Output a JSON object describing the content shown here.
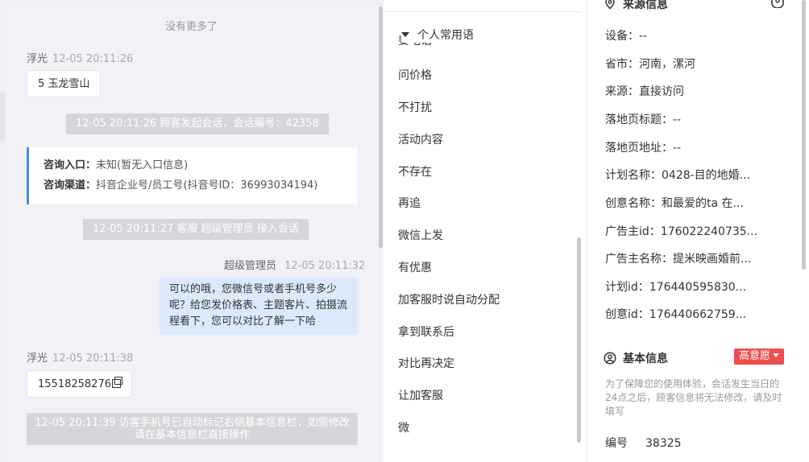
{
  "chat": {
    "no_more": "没有更多了",
    "msg1": {
      "sender": "浮光",
      "time": "12-05 20:11:26",
      "text": "5  玉龙雪山"
    },
    "sys1": "12-05 20:11:26 顾客发起会话，会话编号：42358",
    "card": {
      "entry_label": "咨询入口：",
      "entry_value": "未知(暂无入口信息)",
      "channel_label": "咨询渠道：",
      "channel_value": "抖音企业号/员工号(抖音号ID：36993034194)"
    },
    "sys2": "12-05 20:11:27 客服 超级管理员 接入会话",
    "msg2": {
      "sender": "超级管理员",
      "time": "12-05 20:11:32",
      "text": "可以的哦，您微信号或者手机号多少呢？给您发价格表、主题客片、拍摄流程看下，您可以对比了解一下哈"
    },
    "msg3": {
      "sender": "浮光",
      "time": "12-05 20:11:38",
      "text": "15518258276"
    },
    "sys3": "12-05 20:11:39 访客手机号已自动标记右侧基本信息栏，如需修改请在基本信息栏直接操作"
  },
  "phrases": {
    "header": "个人常用语",
    "cut_item": "要电话",
    "items": [
      "问价格",
      "不打扰",
      "活动内容",
      "不存在",
      "再追",
      "微信上发",
      "有优惠",
      "加客服时说自动分配",
      "拿到联系后",
      "对比再决定",
      "让加客服",
      "微"
    ]
  },
  "source": {
    "title": "来源信息",
    "rows": [
      {
        "k": "设备：",
        "v": "--"
      },
      {
        "k": "省市：",
        "v": "河南，漯河"
      },
      {
        "k": "来源：",
        "v": "直接访问"
      },
      {
        "k": "落地页标题：",
        "v": "--"
      },
      {
        "k": "落地页地址：",
        "v": "--"
      },
      {
        "k": "计划名称：",
        "v": "0428-目的地婚..."
      },
      {
        "k": "创意名称：",
        "v": "和最爱的ta 在..."
      },
      {
        "k": "广告主id：",
        "v": "176022240735..."
      },
      {
        "k": "广告主名称：",
        "v": "提米映画婚前..."
      },
      {
        "k": "计划id：",
        "v": "176440595830..."
      },
      {
        "k": "创意id：",
        "v": "176440662759..."
      }
    ]
  },
  "basic": {
    "title": "基本信息",
    "badge": "高意愿",
    "privacy": "为了保障您的使用体验，会话发生当日的24点之后，顾客信息将无法修改，请及时填写",
    "id_label": "编号",
    "id_value": "38325"
  },
  "colors": {
    "accent": "#3d8ef0",
    "badge": "#ee4d4d",
    "user_bubble": "#dbe9fb"
  }
}
